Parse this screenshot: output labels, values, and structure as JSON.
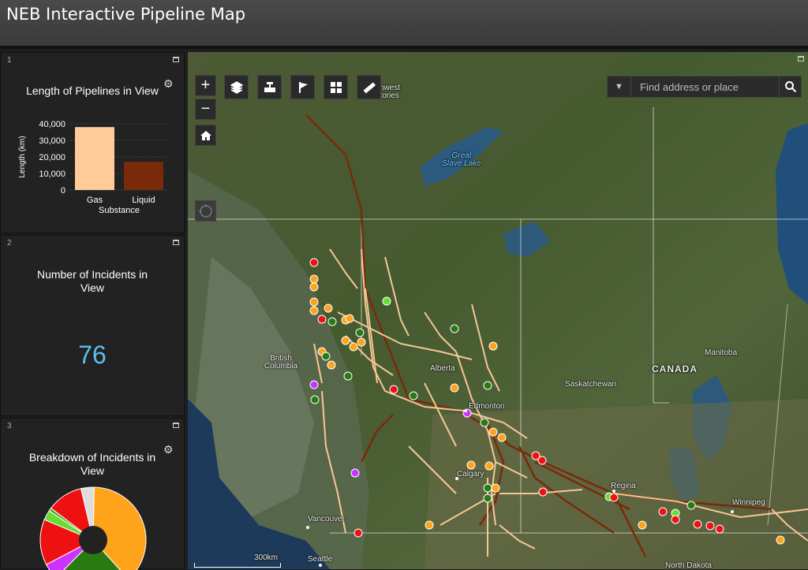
{
  "app": {
    "title": "NEB Interactive Pipeline Map"
  },
  "panels": [
    {
      "number": "1",
      "title": "Length of Pipelines in View"
    },
    {
      "number": "2",
      "title": "Number of Incidents in View",
      "count": "76"
    },
    {
      "number": "3",
      "title": "Breakdown of Incidents in View"
    }
  ],
  "chart_data": [
    {
      "type": "bar",
      "categories": [
        "Gas",
        "Liquid"
      ],
      "values": [
        38000,
        17000
      ],
      "colors": [
        "#ffcc99",
        "#7a2a0a"
      ],
      "xlabel": "Substance",
      "ylabel": "Length (km)",
      "ylim": [
        0,
        40000
      ],
      "yticks": [
        "40,000",
        "30,000",
        "20,000",
        "10,000",
        "0"
      ],
      "grid": true
    },
    {
      "type": "pie",
      "donut": true,
      "slices": [
        {
          "color": "#ffa31a",
          "value": 38
        },
        {
          "color": "#2a7a12",
          "value": 24
        },
        {
          "color": "#cc33ff",
          "value": 5
        },
        {
          "color": "#ee1111",
          "value": 14
        },
        {
          "color": "#66dd33",
          "value": 3
        },
        {
          "color": "#5aaa22",
          "value": 1
        },
        {
          "color": "#ee1111",
          "value": 11
        },
        {
          "color": "#dddddd",
          "value": 4
        }
      ]
    }
  ],
  "search": {
    "placeholder": "Find address or place"
  },
  "map": {
    "labels": {
      "nwt": "Northwest Territories",
      "great_slave_lake": "Great Slave Lake",
      "british_columbia": "British Columbia",
      "alberta": "Alberta",
      "saskatchewan": "Saskatchewan",
      "manitoba": "Manitoba",
      "canada": "CANADA",
      "edmonton": "Edmonton",
      "calgary": "Calgary",
      "regina": "Regina",
      "winnipeg": "Winnipeg",
      "vancouver": "Vancouver",
      "seattle": "Seattle",
      "north_dakota": "North Dakota",
      "scale": "300km"
    },
    "incident_colors": {
      "orange": "#ffa31a",
      "red": "#ee1111",
      "green": "#2a7a12",
      "lightgreen": "#66dd33",
      "purple": "#cc33ff"
    }
  }
}
